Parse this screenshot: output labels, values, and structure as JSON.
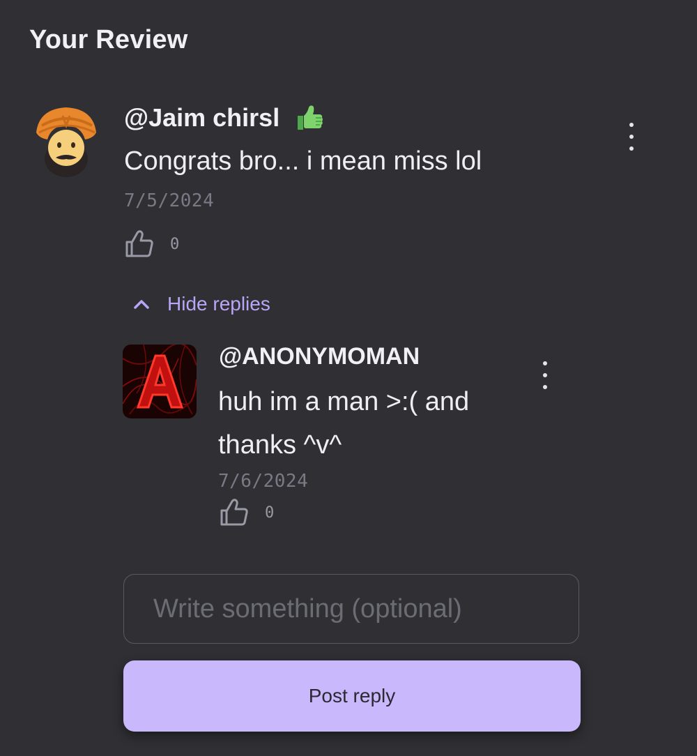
{
  "page": {
    "title": "Your Review"
  },
  "review": {
    "username": "@Jaim chirsl",
    "avatar_icon": "turban-avatar",
    "badge_icon": "thumbs-up-emoji",
    "text": "Congrats bro... i mean miss lol",
    "date": "7/5/2024",
    "like_count": "0"
  },
  "replies_toggle": {
    "label": "Hide replies"
  },
  "reply": {
    "username": "@ANONYMOMAN",
    "avatar_icon": "red-letter-a-avatar",
    "text": "huh im a man >:( and thanks ^v^",
    "date": "7/6/2024",
    "like_count": "0"
  },
  "composer": {
    "placeholder": "Write something (optional)",
    "value": "",
    "submit_label": "Post reply"
  },
  "colors": {
    "background": "#303034",
    "accent": "#c9b8fb",
    "link": "#b9a6f6",
    "muted_text": "#7a7a86"
  }
}
